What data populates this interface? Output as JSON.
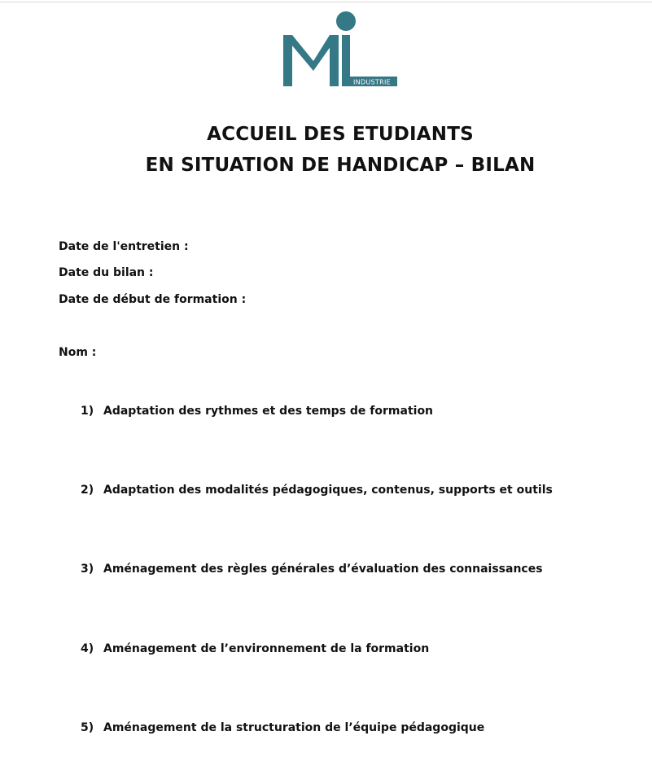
{
  "logo": {
    "tagline": "INDUSTRIE",
    "color": "#357886"
  },
  "title": {
    "line1": "ACCUEIL DES ETUDIANTS",
    "line2": "EN SITUATION DE HANDICAP – BILAN"
  },
  "fields": {
    "interview_date_label": "Date de l'entretien :",
    "review_date_label": "Date du bilan :",
    "training_start_label": "Date de début de formation :",
    "name_label": "Nom :"
  },
  "sections": [
    {
      "number": "1)",
      "label": "Adaptation des rythmes et des temps de formation"
    },
    {
      "number": "2)",
      "label": "Adaptation des modalités pédagogiques, contenus, supports et outils"
    },
    {
      "number": "3)",
      "label": "Aménagement des règles générales d’évaluation des connaissances"
    },
    {
      "number": "4)",
      "label": "Aménagement de l’environnement de la formation"
    },
    {
      "number": "5)",
      "label": "Aménagement de la structuration de l’équipe pédagogique"
    }
  ]
}
